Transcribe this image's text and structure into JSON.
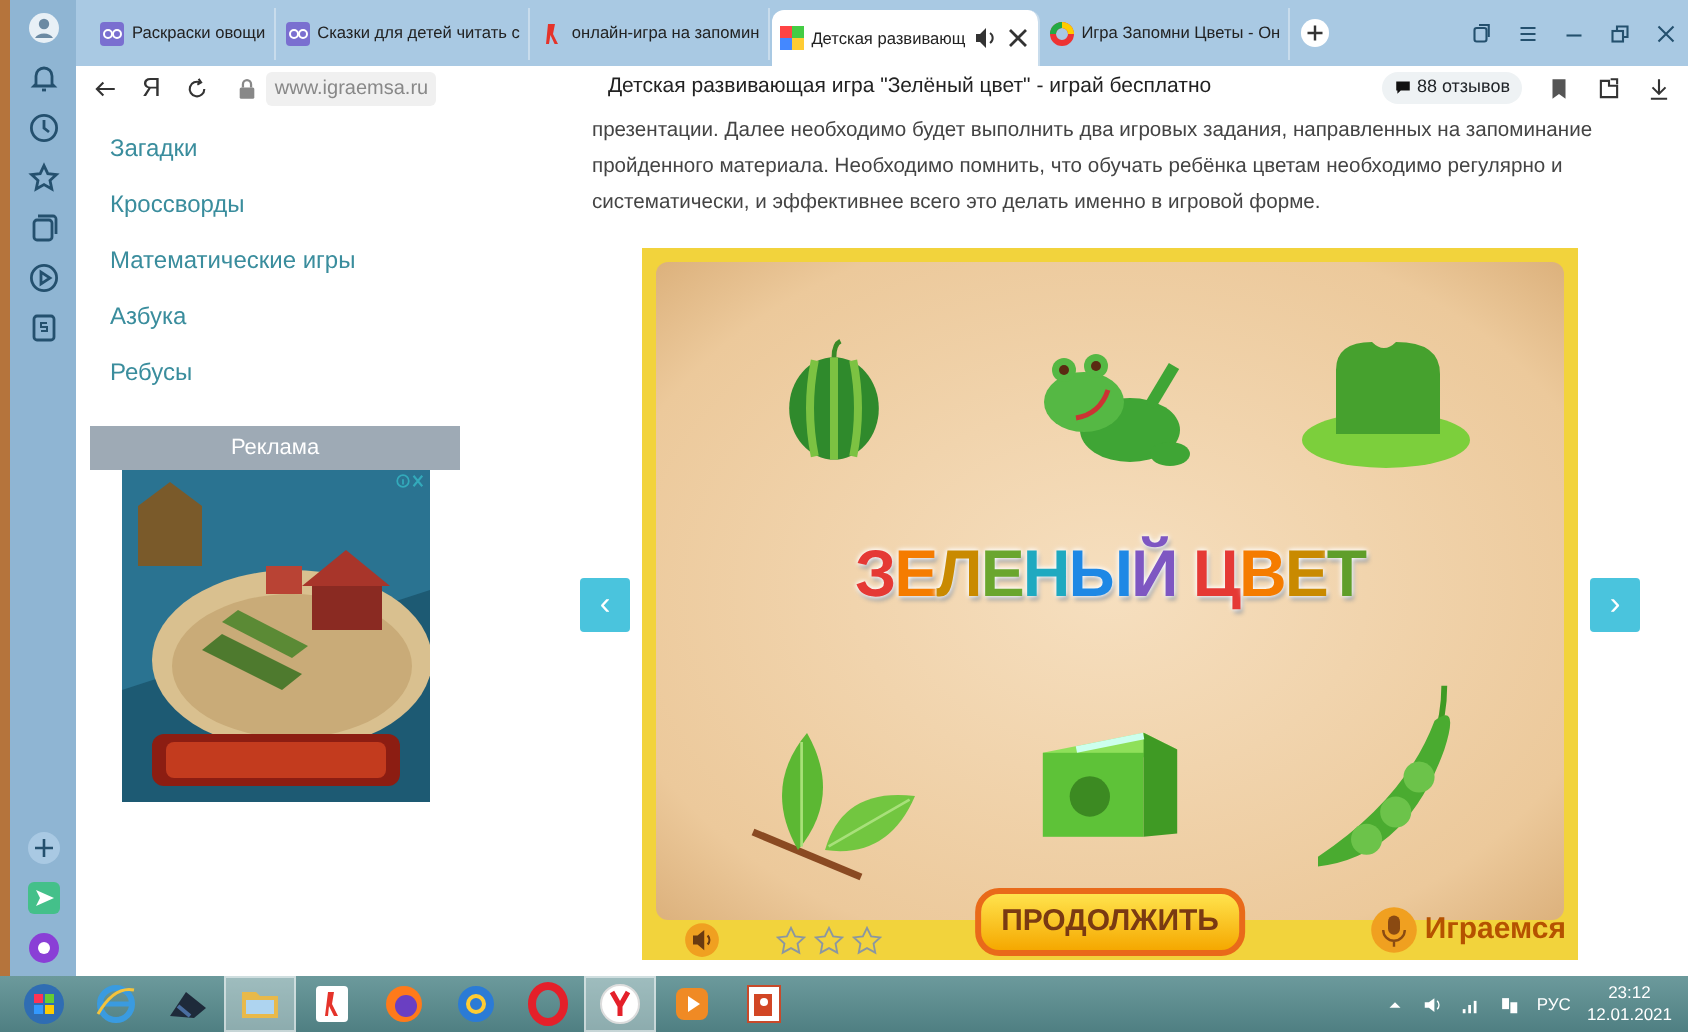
{
  "browser": {
    "tabs": [
      {
        "title": "Раскраски овощи",
        "kind": "site",
        "selected": false,
        "audio": false
      },
      {
        "title": "Сказки для детей читать с",
        "kind": "site",
        "selected": false,
        "audio": false
      },
      {
        "title": "онлайн-игра на запомин",
        "kind": "yandex",
        "selected": false,
        "audio": false
      },
      {
        "title": "Детская развивающ",
        "kind": "mosaic",
        "selected": true,
        "audio": true
      },
      {
        "title": "Игра Запомни Цветы - Он",
        "kind": "ring",
        "selected": false,
        "audio": false
      }
    ],
    "logo": "Я",
    "url": "www.igraemsa.ru",
    "page_title": "Детская развивающая игра \"Зелёный цвет\" - играй бесплатно",
    "reviews": "88 отзывов"
  },
  "nav_links": [
    "Загадки",
    "Кроссворды",
    "Математические игры",
    "Азбука",
    "Ребусы"
  ],
  "ad": {
    "label": "Реклама"
  },
  "article": {
    "text": "презентации. Далее необходимо будет выполнить два игровых задания, направленных на запоминание пройденного материала. Необходимо помнить, что обучать ребёнка цветам необходимо регулярно и систематически, и эффективнее всего это делать именно в игровой форме."
  },
  "game": {
    "prev": "‹",
    "next": "›",
    "title": "ЗЕЛЕНЫЙ ЦВЕТ",
    "items": [
      {
        "kind": "watermelon"
      },
      {
        "kind": "frog"
      },
      {
        "kind": "hat"
      },
      {
        "kind": "leaves"
      },
      {
        "kind": "sharpener"
      },
      {
        "kind": "peas"
      }
    ],
    "continue_button": "ПРОДОЛЖИТЬ",
    "stars": 0,
    "logo": "Играемся"
  },
  "taskbar": {
    "apps": [
      {
        "kind": "start",
        "selected": false
      },
      {
        "kind": "ie",
        "selected": false
      },
      {
        "kind": "dark",
        "selected": false
      },
      {
        "kind": "folder",
        "selected": true
      },
      {
        "kind": "yandex",
        "selected": false
      },
      {
        "kind": "firefox",
        "selected": false
      },
      {
        "kind": "mail",
        "selected": false
      },
      {
        "kind": "opera",
        "selected": false
      },
      {
        "kind": "ybrowser",
        "selected": true
      },
      {
        "kind": "video",
        "selected": false
      },
      {
        "kind": "powerpoint",
        "selected": false
      }
    ],
    "language": "РУС",
    "time": "23:12",
    "date": "12.01.2021"
  }
}
